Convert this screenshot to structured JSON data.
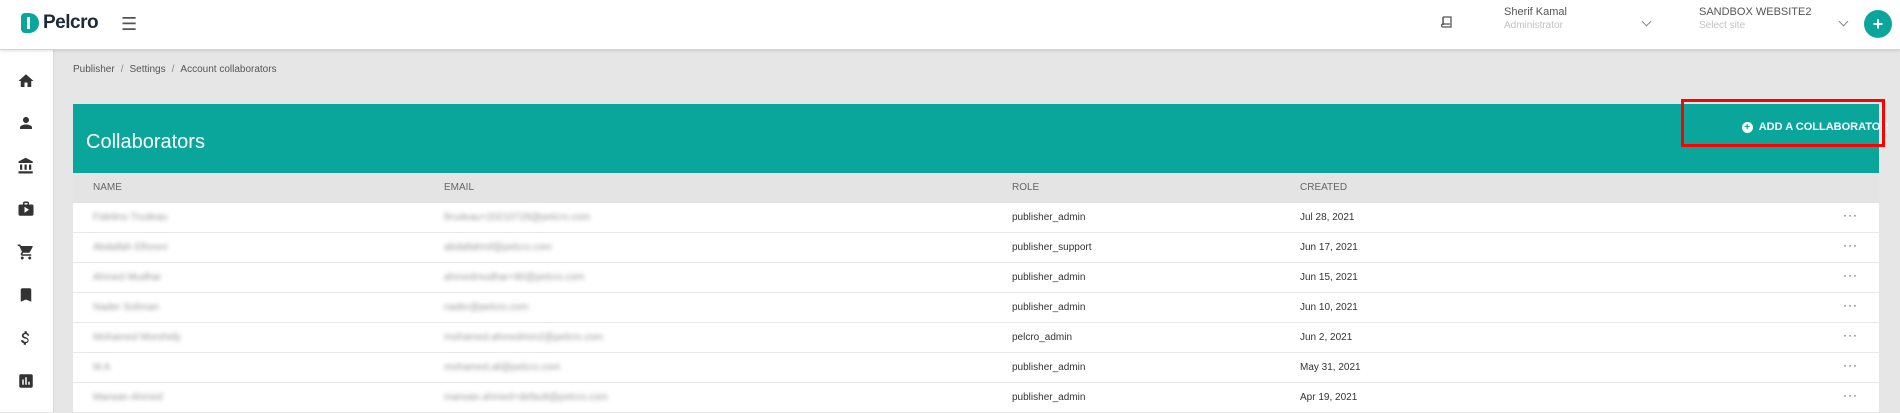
{
  "app": {
    "logo_text": "Pelcro"
  },
  "header": {
    "user": {
      "name": "Sherif Kamal",
      "role": "Administrator"
    },
    "site": {
      "name": "SANDBOX WEBSITE2",
      "placeholder": "Select site"
    },
    "fab_label": "+"
  },
  "sidebar": {
    "items": [
      {
        "name": "home-icon"
      },
      {
        "name": "person-icon"
      },
      {
        "name": "bank-icon"
      },
      {
        "name": "product-icon"
      },
      {
        "name": "cart-icon"
      },
      {
        "name": "bookmark-icon"
      },
      {
        "name": "dollar-icon"
      },
      {
        "name": "report-icon"
      }
    ]
  },
  "breadcrumb": [
    "Publisher",
    "Settings",
    "Account collaborators"
  ],
  "page": {
    "title": "Collaborators",
    "add_button": "ADD A COLLABORATOR"
  },
  "table": {
    "columns": [
      "NAME",
      "EMAIL",
      "ROLE",
      "CREATED"
    ],
    "rows": [
      {
        "name": "Fidelino Trudeau",
        "email": "ftrudeau+20210728@pelcro.com",
        "role": "publisher_admin",
        "created": "Jul 28, 2021"
      },
      {
        "name": "Abdallah Elhosni",
        "email": "abdallahrsf@pelcro.com",
        "role": "publisher_support",
        "created": "Jun 17, 2021"
      },
      {
        "name": "Ahmed Mudhar",
        "email": "ahmedmudhar+80@pelcro.com",
        "role": "publisher_admin",
        "created": "Jun 15, 2021"
      },
      {
        "name": "Nader Soliman",
        "email": "nader@pelcro.com",
        "role": "publisher_admin",
        "created": "Jun 10, 2021"
      },
      {
        "name": "Mohamed Morshidy",
        "email": "mohamed.ahmedmm2@pelcro.com",
        "role": "pelcro_admin",
        "created": "Jun 2, 2021"
      },
      {
        "name": "M A",
        "email": "mohamed.ali@pelcro.com",
        "role": "publisher_admin",
        "created": "May 31, 2021"
      },
      {
        "name": "Marwan Ahmed",
        "email": "marwan.ahmed+default@pelcro.com",
        "role": "publisher_admin",
        "created": "Apr 19, 2021"
      }
    ],
    "row_menu": "···"
  },
  "colors": {
    "accent": "#0aa69b",
    "highlight": "#ff0000"
  }
}
